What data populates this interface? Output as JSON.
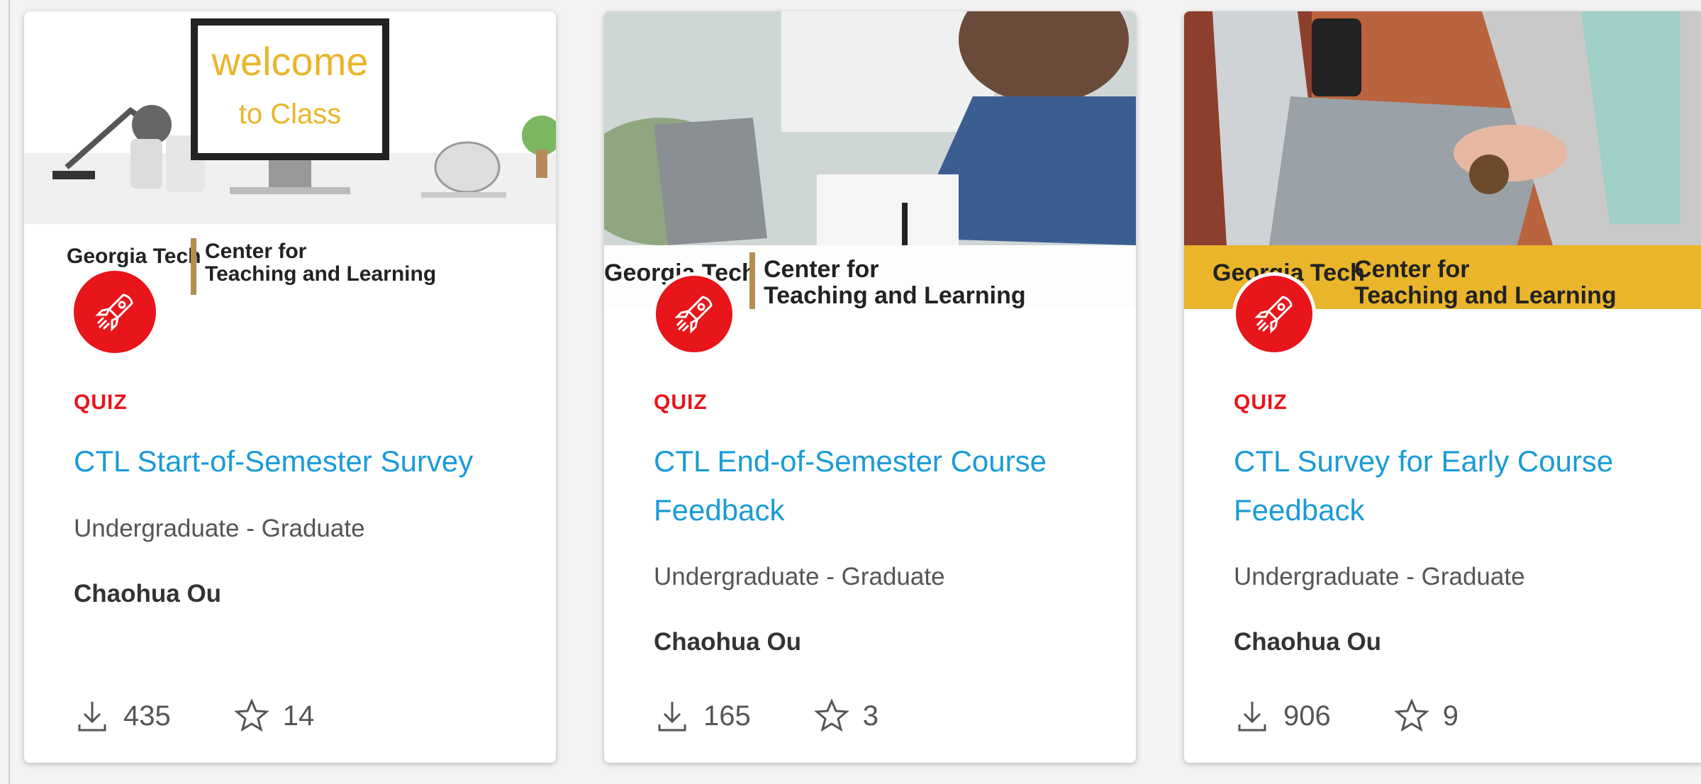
{
  "cards": [
    {
      "banner": {
        "monitor_line1": "welcome",
        "monitor_line2": "to Class",
        "logo_left": "Georgia Tech",
        "logo_right_1": "Center for",
        "logo_right_2": "Teaching and Learning"
      },
      "type": "QUIZ",
      "title": "CTL Start-of-Semester Survey",
      "level": "Undergraduate - Graduate",
      "author": "Chaohua Ou",
      "downloads": "435",
      "favorites": "14"
    },
    {
      "banner": {
        "logo_left": "Georgia Tech",
        "logo_right_1": "Center for",
        "logo_right_2": "Teaching and Learning"
      },
      "type": "QUIZ",
      "title": "CTL End-of-Semester Course Feedback",
      "level": "Undergraduate - Graduate",
      "author": "Chaohua Ou",
      "downloads": "165",
      "favorites": "3"
    },
    {
      "banner": {
        "logo_left": "Georgia Tech",
        "logo_right_1": "Center for",
        "logo_right_2": "Teaching and Learning"
      },
      "type": "QUIZ",
      "title": "CTL Survey for Early Course Feedback",
      "level": "Undergraduate - Graduate",
      "author": "Chaohua Ou",
      "downloads": "906",
      "favorites": "9"
    }
  ],
  "icons": {
    "badge": "rocket-icon",
    "downloads": "download-icon",
    "favorites": "star-outline-icon"
  },
  "colors": {
    "accent_red": "#e8151b",
    "title_blue": "#1a9bd7",
    "gt_gold": "#eab52a"
  }
}
